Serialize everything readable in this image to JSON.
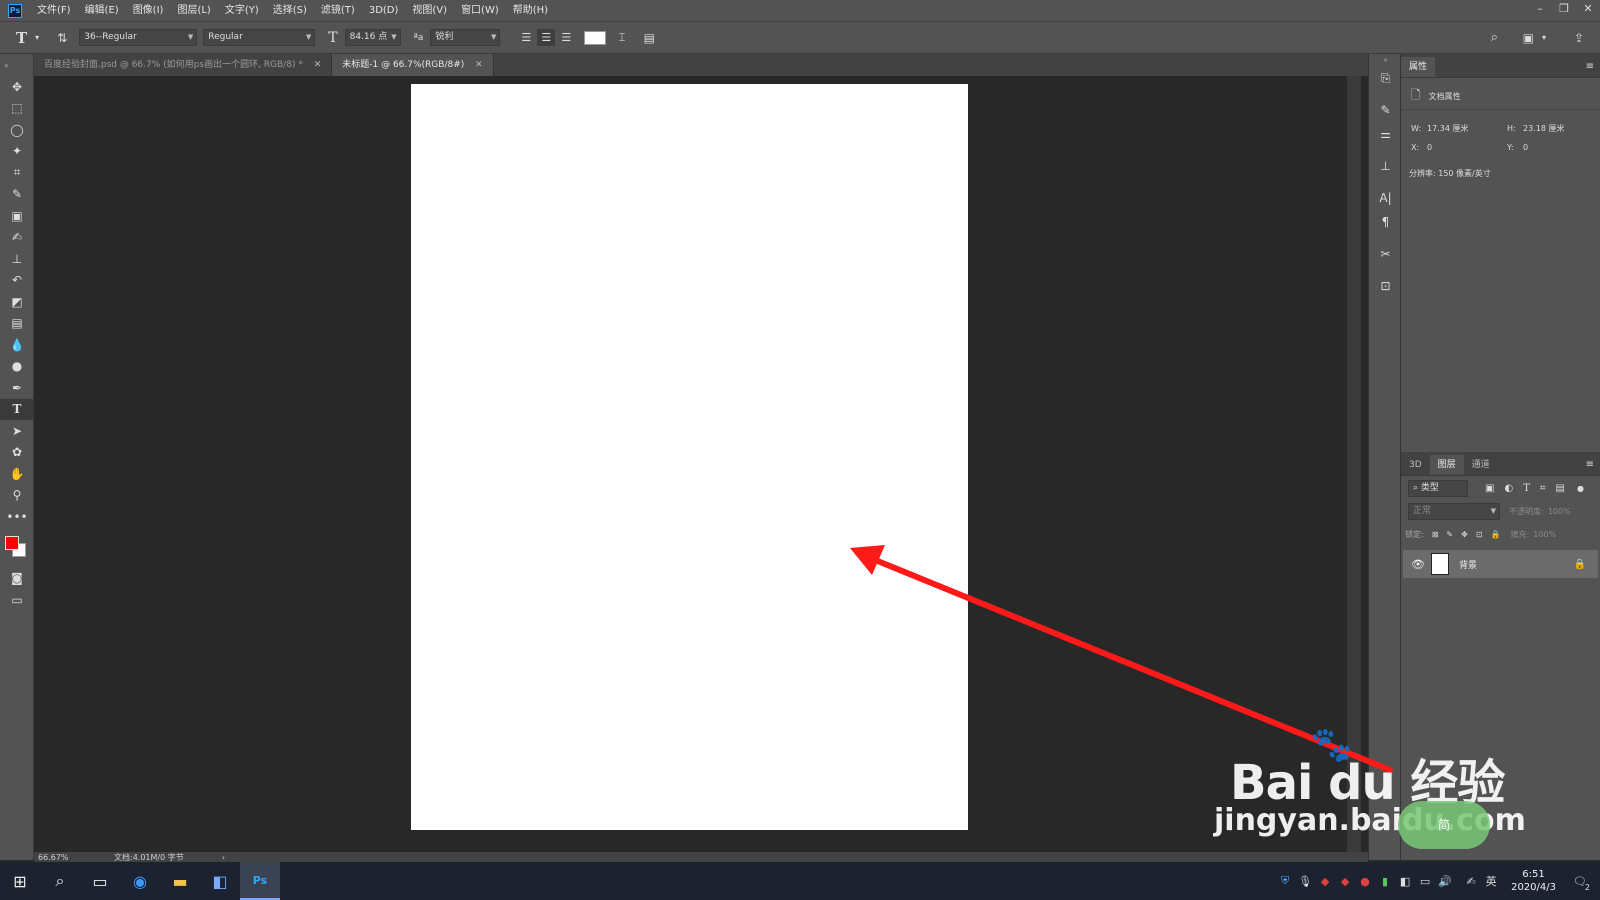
{
  "app": {
    "logo": "Ps"
  },
  "menu": [
    "文件(F)",
    "编辑(E)",
    "图像(I)",
    "图层(L)",
    "文字(Y)",
    "选择(S)",
    "滤镜(T)",
    "3D(D)",
    "视图(V)",
    "窗口(W)",
    "帮助(H)"
  ],
  "window_controls": {
    "minimize": "–",
    "restore": "❐",
    "close": "✕"
  },
  "options": {
    "font_family": "36--Regular",
    "font_style": "Regular",
    "font_size": "84.16 点",
    "antialias": "锐利",
    "text_color": "#ffffff"
  },
  "tabs": [
    {
      "label": "百度经验封面.psd @ 66.7% (如何用ps画出一个圆环, RGB/8) *",
      "active": false
    },
    {
      "label": "未标题-1 @ 66.7%(RGB/8#)",
      "active": true
    }
  ],
  "colors": {
    "foreground": "#ff0000",
    "background": "#ffffff",
    "arrow": "#ff1a1a"
  },
  "status": {
    "zoom": "66.67%",
    "doc_info": "文档:4.01M/0 字节"
  },
  "properties_panel": {
    "tab": "属性",
    "section_title": "文档属性",
    "w_label": "W:",
    "w_value": "17.34 厘米",
    "h_label": "H:",
    "h_value": "23.18 厘米",
    "x_label": "X:",
    "x_value": "0",
    "y_label": "Y:",
    "y_value": "0",
    "resolution": "分辨率: 150 像素/英寸"
  },
  "layers_panel": {
    "tabs": [
      "3D",
      "图层",
      "通道"
    ],
    "filter_placeholder": "类型",
    "blend_mode": "正常",
    "opacity_label": "不透明度:",
    "opacity_value": "100%",
    "lock_label": "锁定:",
    "fill_label": "填充:",
    "fill_value": "100%",
    "layers": [
      {
        "name": "背景",
        "locked": true,
        "visible": true
      }
    ]
  },
  "taskbar": {
    "clock_time": "6:51",
    "clock_date": "2020/4/3",
    "ime": "英",
    "notification_count": "2"
  },
  "watermark": {
    "brand": "Bai du 经验",
    "url": "jingyan.baidu.com",
    "badge": "简"
  }
}
